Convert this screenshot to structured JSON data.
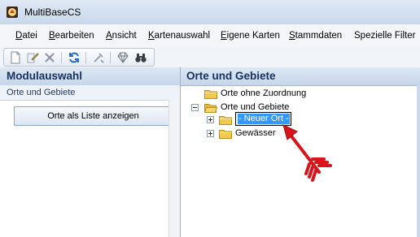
{
  "window": {
    "title": "MultiBaseCS",
    "app_icon": "app-icon"
  },
  "menu": [
    {
      "label": "Datei",
      "key": "D",
      "rest": "atei"
    },
    {
      "label": "Bearbeiten",
      "key": "B",
      "rest": "earbeiten"
    },
    {
      "label": "Ansicht",
      "key": "A",
      "rest": "nsicht"
    },
    {
      "label": "Kartenauswahl",
      "key": "K",
      "rest": "artenauswahl"
    },
    {
      "label": "Eigene Karten",
      "key": "E",
      "rest": "igene Karten"
    },
    {
      "label": "Stammdaten",
      "key": "S",
      "rest": "tammdaten"
    },
    {
      "label": "Spezielle Filter",
      "key": "",
      "rest": "Spezielle Filter"
    }
  ],
  "toolbar": {
    "icons": [
      "new-document-icon",
      "edit-icon",
      "delete-icon",
      "refresh-icon",
      "tools-icon",
      "diamond-icon",
      "binoculars-icon"
    ]
  },
  "left_panel": {
    "title": "Modulauswahl",
    "section": "Orte und Gebiete",
    "button_label": "Orte als Liste anzeigen"
  },
  "right_panel": {
    "title": "Orte und Gebiete",
    "tree": {
      "unassigned": "Orte ohne Zuordnung",
      "root": "Orte und Gebiete",
      "new_node": "- Neuer Ort -",
      "waters": "Gewässer"
    }
  },
  "colors": {
    "header_text": "#15315e",
    "selection": "#3399ff",
    "arrow": "#d9151b"
  }
}
